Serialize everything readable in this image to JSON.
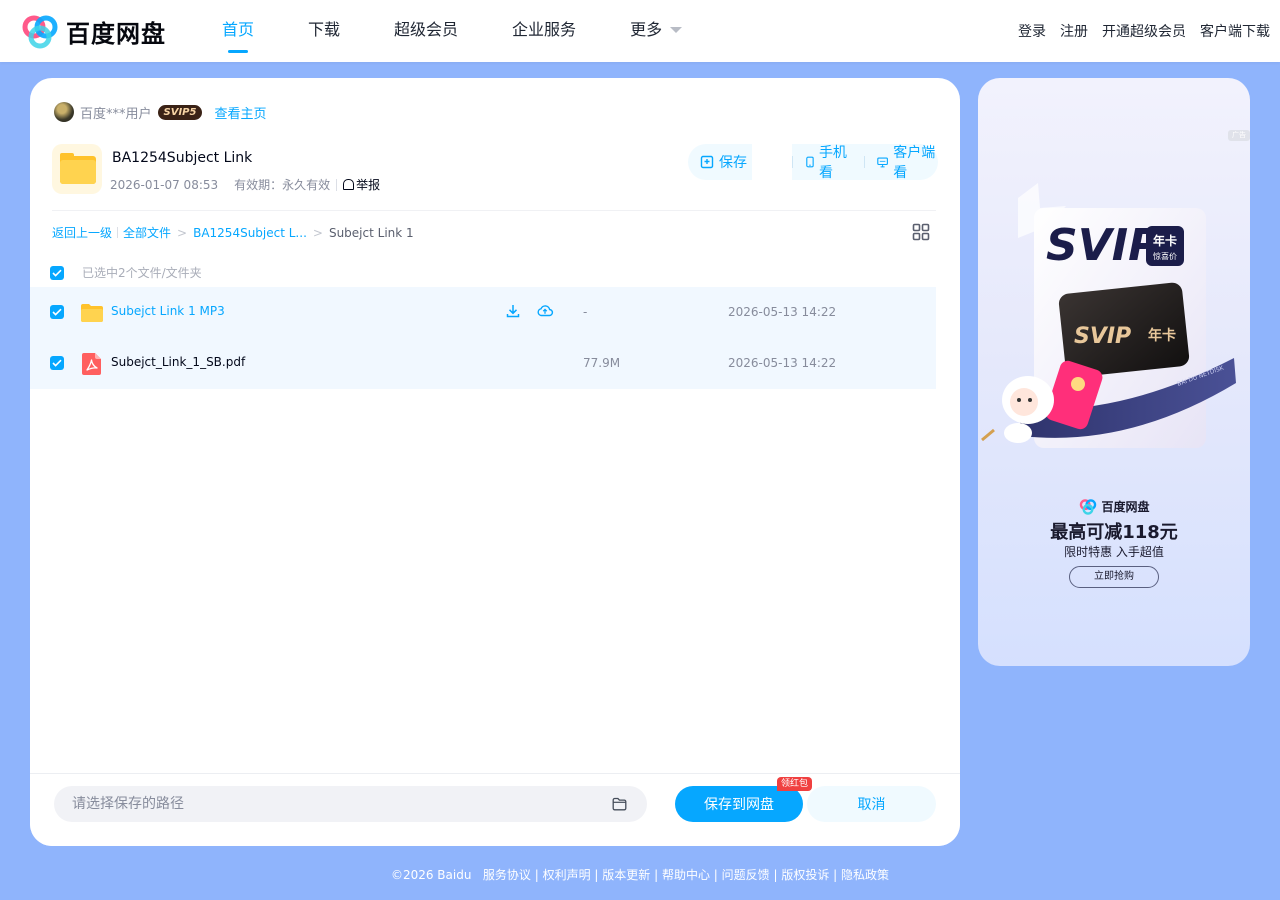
{
  "header": {
    "logo_text": "百度网盘",
    "nav": [
      {
        "label": "首页",
        "active": true
      },
      {
        "label": "下载",
        "active": false
      },
      {
        "label": "超级会员",
        "active": false
      },
      {
        "label": "企业服务",
        "active": false
      },
      {
        "label": "更多",
        "active": false
      }
    ],
    "links": [
      "登录",
      "注册",
      "开通超级会员",
      "客户端下载"
    ]
  },
  "share": {
    "sharer_name": "百度***用户",
    "vip_badge": "SVIP5",
    "sharer_link": "查看主页",
    "folder_title": "BA1254Subject Link",
    "created": "2026-01-07 08:53",
    "expiry": "有效期：永久有效",
    "report": "举报",
    "save_button": "保存",
    "phone_button": "手机看",
    "client_button": "客户端看"
  },
  "breadcrumb": {
    "root": "返回上一级",
    "all": "全部文件",
    "folder": "BA1254Subject L...",
    "current": "Subejct Link 1"
  },
  "list": {
    "select_all_text": "已选中2个文件/文件夹",
    "files": [
      {
        "name": "Subejct Link 1 MP3",
        "type": "folder",
        "size": "-",
        "date": "2026-05-13 14:22"
      },
      {
        "name": "Subejct_Link_1_SB.pdf",
        "type": "pdf",
        "size": "77.9M",
        "date": "2026-05-13 14:22"
      }
    ]
  },
  "bottom": {
    "path_placeholder": "请选择保存的路径",
    "save_button": "保存到网盘",
    "hongbao": "领红包",
    "cancel_button": "取消"
  },
  "ad": {
    "tag": "广告",
    "svip_title": "SVIP",
    "card_label": "年卡",
    "card_sub": "惊喜价",
    "ribbon": "BAI DU NETDISK",
    "brand": "百度网盘",
    "headline": "最高可减118元",
    "sub": "限时特惠 入手超值",
    "cta": "立即抢购"
  },
  "footer": {
    "copyright": "©2026 Baidu",
    "links": [
      "服务协议",
      "权利声明",
      "版本更新",
      "帮助中心",
      "问题反馈",
      "版权投诉",
      "隐私政策"
    ]
  },
  "colors": {
    "accent": "#06a7ff",
    "page_bg": "#8fb4fc",
    "row_selected": "#f1f8ff"
  }
}
